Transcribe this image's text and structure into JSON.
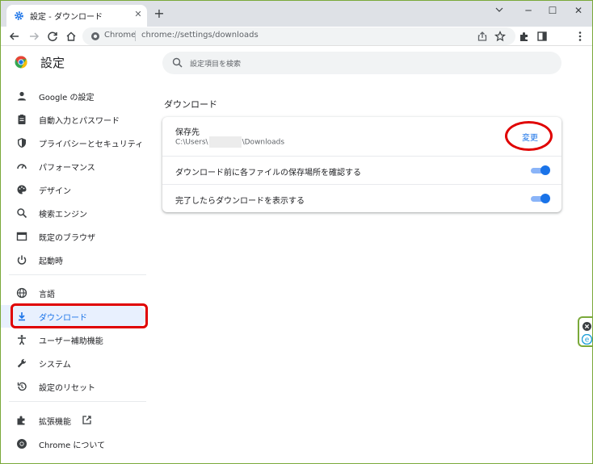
{
  "tab": {
    "title": "設定 - ダウンロード",
    "close": "✕"
  },
  "window": {
    "new_tab": "+",
    "minimize": "─",
    "maximize": "☐",
    "close": "✕"
  },
  "omnibox": {
    "site_label": "Chrome",
    "url": "chrome://settings/downloads"
  },
  "page": {
    "title": "設定",
    "search_placeholder": "設定項目を検索"
  },
  "sidebar": {
    "items": [
      {
        "label": "Google の設定",
        "icon": "person-icon"
      },
      {
        "label": "自動入力とパスワード",
        "icon": "clipboard-icon"
      },
      {
        "label": "プライバシーとセキュリティ",
        "icon": "shield-icon"
      },
      {
        "label": "パフォーマンス",
        "icon": "speedometer-icon"
      },
      {
        "label": "デザイン",
        "icon": "palette-icon"
      },
      {
        "label": "検索エンジン",
        "icon": "search-icon"
      },
      {
        "label": "既定のブラウザ",
        "icon": "browser-icon"
      },
      {
        "label": "起動時",
        "icon": "power-icon"
      },
      {
        "label": "言語",
        "icon": "globe-icon"
      },
      {
        "label": "ダウンロード",
        "icon": "download-icon"
      },
      {
        "label": "ユーザー補助機能",
        "icon": "accessibility-icon"
      },
      {
        "label": "システム",
        "icon": "wrench-icon"
      },
      {
        "label": "設定のリセット",
        "icon": "reset-icon"
      },
      {
        "label": "拡張機能",
        "icon": "puzzle-icon"
      },
      {
        "label": "Chrome について",
        "icon": "chrome-logo-icon"
      }
    ]
  },
  "downloads": {
    "section_title": "ダウンロード",
    "location_label": "保存先",
    "path_prefix": "C:\\Users\\",
    "path_suffix": "\\Downloads",
    "change_label": "変更",
    "ask_label": "ダウンロード前に各ファイルの保存場所を確認する",
    "ask_enabled": true,
    "show_label": "完了したらダウンロードを表示する",
    "show_enabled": true
  },
  "colors": {
    "accent": "#1a73e8",
    "annotation": "#e00000",
    "frame": "#7aa93a"
  }
}
